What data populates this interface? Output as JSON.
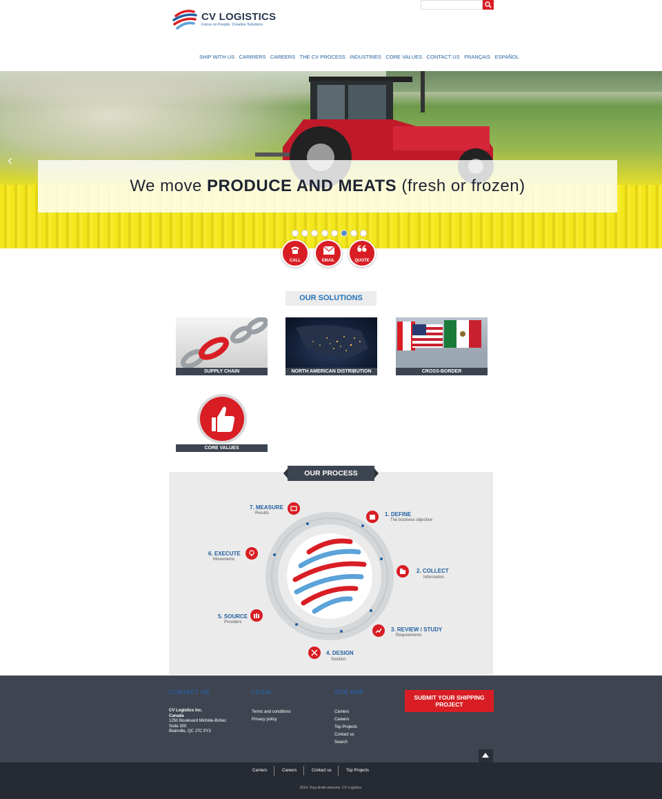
{
  "header": {
    "logo_name": "CV LOGISTICS",
    "logo_tagline": "Focus on People. Creative Solutions",
    "search_placeholder": "",
    "nav": [
      "SHIP WITH US",
      "CARRIERS",
      "CAREERS",
      "THE CV PROCESS",
      "INDUSTRIES",
      "CORE VALUES",
      "CONTACT US",
      "FRANÇAIS",
      "ESPAÑOL"
    ]
  },
  "hero": {
    "caption_pre": "We move ",
    "caption_bold": "PRODUCE AND MEATS",
    "caption_post": " (fresh or frozen)",
    "slide_count": 8,
    "active_slide": 6
  },
  "quick_actions": [
    "CALL",
    "EMAIL",
    "QUOTE"
  ],
  "solutions": {
    "title": "OUR SOLUTIONS",
    "items": [
      "SUPPLY CHAIN",
      "NORTH AMERICAN DISTRIBUTION",
      "CROSS-BORDER",
      "CORE VALUES"
    ]
  },
  "process": {
    "title": "OUR PROCESS",
    "steps": [
      {
        "title": "1. DEFINE",
        "sub": "The business objective"
      },
      {
        "title": "2. COLLECT",
        "sub": "Information"
      },
      {
        "title": "3. REVIEW / STUDY",
        "sub": "Requirements"
      },
      {
        "title": "4. DESIGN",
        "sub": "Solution"
      },
      {
        "title": "5. SOURCE",
        "sub": "Providers"
      },
      {
        "title": "6. EXECUTE",
        "sub": "Movements"
      },
      {
        "title": "7. MEASURE",
        "sub": "Results"
      }
    ]
  },
  "footer": {
    "contact_title": "CONTACT US",
    "company": "CV Logistics Inc.",
    "country": "Canada",
    "address": [
      "1250 Boulevard Michèle-Bohec",
      "Suite 300",
      "Blainville, QC J7C 5Y3"
    ],
    "legal_title": "LEGAL",
    "legal_links": [
      "Terms and conditions",
      "Privacy policy"
    ],
    "sitemap_title": "SITE MAP",
    "sitemap_links": [
      "Carriers",
      "Careers",
      "Top Projects",
      "Contact us",
      "Search"
    ],
    "submit_label": "SUBMIT YOUR SHIPPING PROJECT",
    "bottom_links": [
      "Carriers",
      "Careers",
      "Contact us",
      "Top Projects"
    ],
    "copyright": "2014. Tous droits réservés. CV Logistics."
  },
  "colors": {
    "brand_red": "#d81e24",
    "brand_blue": "#1f5e9e",
    "dark_bar": "#3c4450"
  }
}
